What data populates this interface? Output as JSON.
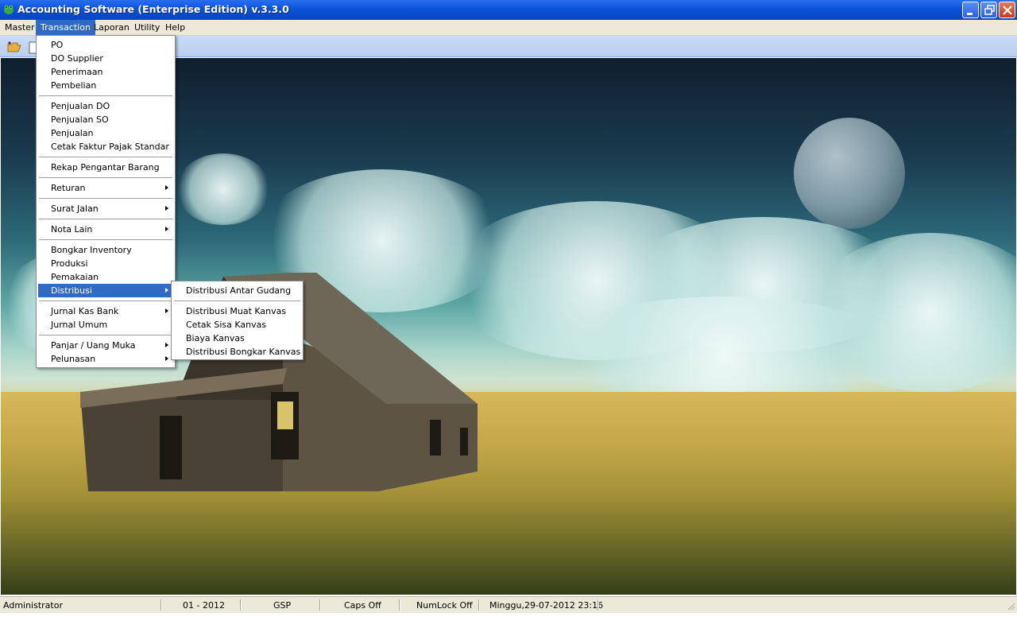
{
  "window": {
    "title": "Accounting Software (Enterprise Edition) v.3.3.0",
    "app_icon": "frog-app-icon",
    "controls": [
      "minimize-icon",
      "restore-icon",
      "close-icon"
    ]
  },
  "menubar": {
    "items": [
      {
        "label": "Master"
      },
      {
        "label": "Transaction"
      },
      {
        "label": "Laporan"
      },
      {
        "label": "Utility"
      },
      {
        "label": "Help"
      }
    ],
    "active": "Transaction"
  },
  "toolbar": {
    "icons": [
      "open-folder-icon",
      "document-icon"
    ]
  },
  "transaction_menu": {
    "items": [
      {
        "label": "PO"
      },
      {
        "label": "DO Supplier"
      },
      {
        "label": "Penerimaan"
      },
      {
        "label": "Pembelian"
      },
      {
        "label": "Penjualan DO"
      },
      {
        "label": "Penjualan SO"
      },
      {
        "label": "Penjualan"
      },
      {
        "label": "Cetak Faktur Pajak Standar"
      },
      {
        "label": "Rekap Pengantar Barang"
      },
      {
        "label": "Returan"
      },
      {
        "label": "Surat Jalan"
      },
      {
        "label": "Nota Lain"
      },
      {
        "label": "Bongkar Inventory"
      },
      {
        "label": "Produksi"
      },
      {
        "label": "Pemakaian"
      },
      {
        "label": "Distribusi"
      },
      {
        "label": "Jurnal Kas Bank"
      },
      {
        "label": "Jurnal Umum"
      },
      {
        "label": "Panjar / Uang Muka"
      },
      {
        "label": "Pelunasan"
      }
    ],
    "highlighted": "Distribusi"
  },
  "distribusi_submenu": {
    "items": [
      {
        "label": "Distribusi Antar Gudang"
      },
      {
        "label": "Distribusi Muat Kanvas"
      },
      {
        "label": "Cetak Sisa Kanvas"
      },
      {
        "label": "Biaya Kanvas"
      },
      {
        "label": "Distribusi Bongkar Kanvas"
      }
    ]
  },
  "statusbar": {
    "user": "Administrator",
    "period": "01 - 2012",
    "company": "GSP",
    "caps": "Caps Off",
    "numlock": "NumLock Off",
    "datetime": "Minggu,29-07-2012 23:16"
  },
  "colors": {
    "titlebar": "#0a52d8",
    "menu_highlight": "#316ac5",
    "menubar_bg": "#ece9d8",
    "toolbar_bg": "#c9dcf7"
  }
}
